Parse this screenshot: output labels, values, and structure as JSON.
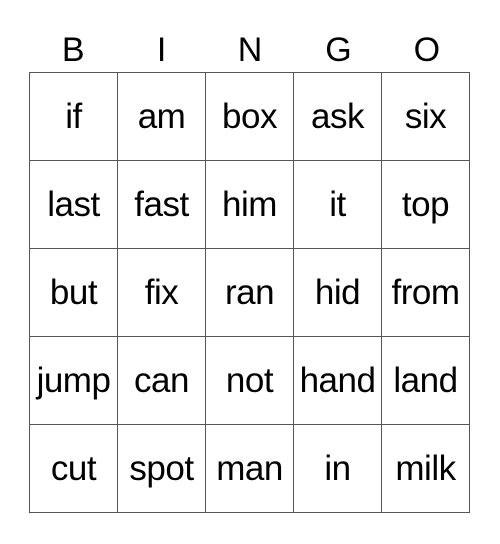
{
  "header": [
    "B",
    "I",
    "N",
    "G",
    "O"
  ],
  "rows": [
    [
      "if",
      "am",
      "box",
      "ask",
      "six"
    ],
    [
      "last",
      "fast",
      "him",
      "it",
      "top"
    ],
    [
      "but",
      "fix",
      "ran",
      "hid",
      "from"
    ],
    [
      "jump",
      "can",
      "not",
      "hand",
      "land"
    ],
    [
      "cut",
      "spot",
      "man",
      "in",
      "milk"
    ]
  ]
}
